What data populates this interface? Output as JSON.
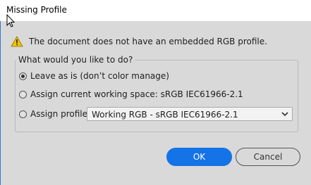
{
  "window": {
    "title": "Missing Profile"
  },
  "message": "The document does not have an embedded RGB profile.",
  "group_label": "What would you like to do?",
  "options": [
    {
      "label": "Leave as is (don’t color manage)",
      "selected": true
    },
    {
      "label": "Assign current working space: sRGB IEC61966-2.1",
      "selected": false
    },
    {
      "label": "Assign profile:",
      "selected": false
    }
  ],
  "profile_select": {
    "value": "Working RGB - sRGB IEC61966-2.1"
  },
  "buttons": {
    "ok": "OK",
    "cancel": "Cancel"
  },
  "colors": {
    "accent": "#1473e6",
    "dialog_bg": "#d9d9d9",
    "warning": "#f0c400"
  },
  "icons": {
    "warning": "warning-icon",
    "cursor": "cursor-icon",
    "dropdown": "chevron-down-icon"
  }
}
